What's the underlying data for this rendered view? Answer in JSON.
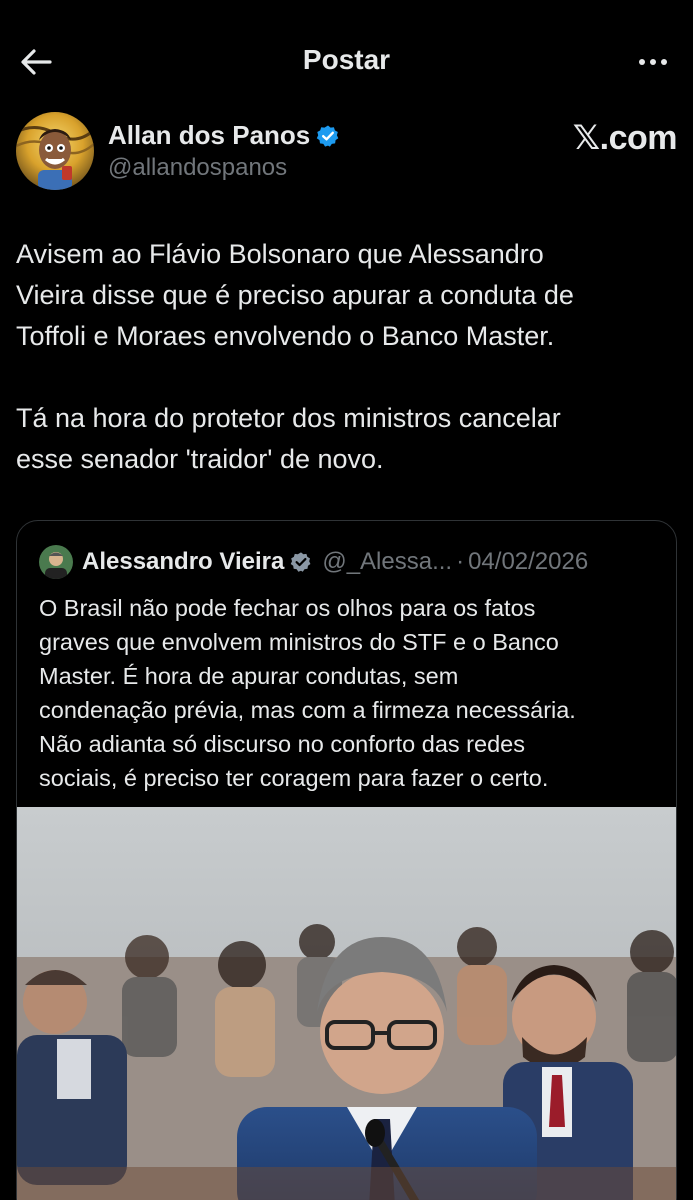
{
  "header": {
    "title": "Postar",
    "back_icon": "arrow-left-icon",
    "more_icon": "more-horizontal-icon"
  },
  "author": {
    "name": "Allan dos Panos",
    "handle": "@allandospanos",
    "verified": true,
    "verified_color": "#1d9bf0"
  },
  "brand": "𝕏.com",
  "post": {
    "text": "Avisem ao Flávio Bolsonaro que Alessandro\nVieira disse que é preciso apurar a conduta de\nToffoli e Moraes envolvendo o Banco Master.\n\nTá na hora do protetor dos ministros cancelar\nesse senador 'traidor' de novo."
  },
  "quote": {
    "name": "Alessandro Vieira",
    "verified": true,
    "handle": "@_Alessa...",
    "separator": "·",
    "date": "04/02/2026",
    "text": "O Brasil não pode fechar os olhos para os fatos\ngraves que envolvem ministros do STF e o Banco\nMaster. É hora de apurar condutas, sem\ncondenação prévia, mas com a firmeza necessária.\nNão adianta só discurso no conforto das redes\nsociais, é preciso ter coragem para fazer o certo."
  },
  "colors": {
    "background": "#000000",
    "text": "#e7e9ea",
    "secondary": "#71767b",
    "border": "#2f3336",
    "verified": "#1d9bf0"
  }
}
